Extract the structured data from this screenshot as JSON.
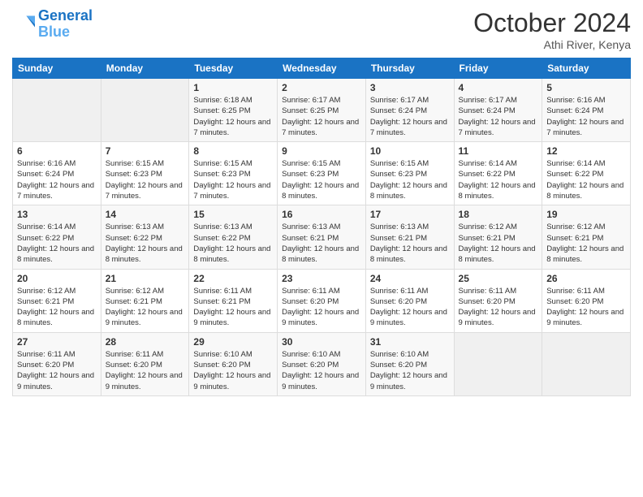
{
  "logo": {
    "line1": "General",
    "line2": "Blue"
  },
  "title": "October 2024",
  "subtitle": "Athi River, Kenya",
  "days_header": [
    "Sunday",
    "Monday",
    "Tuesday",
    "Wednesday",
    "Thursday",
    "Friday",
    "Saturday"
  ],
  "weeks": [
    [
      {
        "day": "",
        "info": ""
      },
      {
        "day": "",
        "info": ""
      },
      {
        "day": "1",
        "info": "Sunrise: 6:18 AM\nSunset: 6:25 PM\nDaylight: 12 hours and 7 minutes."
      },
      {
        "day": "2",
        "info": "Sunrise: 6:17 AM\nSunset: 6:25 PM\nDaylight: 12 hours and 7 minutes."
      },
      {
        "day": "3",
        "info": "Sunrise: 6:17 AM\nSunset: 6:24 PM\nDaylight: 12 hours and 7 minutes."
      },
      {
        "day": "4",
        "info": "Sunrise: 6:17 AM\nSunset: 6:24 PM\nDaylight: 12 hours and 7 minutes."
      },
      {
        "day": "5",
        "info": "Sunrise: 6:16 AM\nSunset: 6:24 PM\nDaylight: 12 hours and 7 minutes."
      }
    ],
    [
      {
        "day": "6",
        "info": "Sunrise: 6:16 AM\nSunset: 6:24 PM\nDaylight: 12 hours and 7 minutes."
      },
      {
        "day": "7",
        "info": "Sunrise: 6:15 AM\nSunset: 6:23 PM\nDaylight: 12 hours and 7 minutes."
      },
      {
        "day": "8",
        "info": "Sunrise: 6:15 AM\nSunset: 6:23 PM\nDaylight: 12 hours and 7 minutes."
      },
      {
        "day": "9",
        "info": "Sunrise: 6:15 AM\nSunset: 6:23 PM\nDaylight: 12 hours and 8 minutes."
      },
      {
        "day": "10",
        "info": "Sunrise: 6:15 AM\nSunset: 6:23 PM\nDaylight: 12 hours and 8 minutes."
      },
      {
        "day": "11",
        "info": "Sunrise: 6:14 AM\nSunset: 6:22 PM\nDaylight: 12 hours and 8 minutes."
      },
      {
        "day": "12",
        "info": "Sunrise: 6:14 AM\nSunset: 6:22 PM\nDaylight: 12 hours and 8 minutes."
      }
    ],
    [
      {
        "day": "13",
        "info": "Sunrise: 6:14 AM\nSunset: 6:22 PM\nDaylight: 12 hours and 8 minutes."
      },
      {
        "day": "14",
        "info": "Sunrise: 6:13 AM\nSunset: 6:22 PM\nDaylight: 12 hours and 8 minutes."
      },
      {
        "day": "15",
        "info": "Sunrise: 6:13 AM\nSunset: 6:22 PM\nDaylight: 12 hours and 8 minutes."
      },
      {
        "day": "16",
        "info": "Sunrise: 6:13 AM\nSunset: 6:21 PM\nDaylight: 12 hours and 8 minutes."
      },
      {
        "day": "17",
        "info": "Sunrise: 6:13 AM\nSunset: 6:21 PM\nDaylight: 12 hours and 8 minutes."
      },
      {
        "day": "18",
        "info": "Sunrise: 6:12 AM\nSunset: 6:21 PM\nDaylight: 12 hours and 8 minutes."
      },
      {
        "day": "19",
        "info": "Sunrise: 6:12 AM\nSunset: 6:21 PM\nDaylight: 12 hours and 8 minutes."
      }
    ],
    [
      {
        "day": "20",
        "info": "Sunrise: 6:12 AM\nSunset: 6:21 PM\nDaylight: 12 hours and 8 minutes."
      },
      {
        "day": "21",
        "info": "Sunrise: 6:12 AM\nSunset: 6:21 PM\nDaylight: 12 hours and 9 minutes."
      },
      {
        "day": "22",
        "info": "Sunrise: 6:11 AM\nSunset: 6:21 PM\nDaylight: 12 hours and 9 minutes."
      },
      {
        "day": "23",
        "info": "Sunrise: 6:11 AM\nSunset: 6:20 PM\nDaylight: 12 hours and 9 minutes."
      },
      {
        "day": "24",
        "info": "Sunrise: 6:11 AM\nSunset: 6:20 PM\nDaylight: 12 hours and 9 minutes."
      },
      {
        "day": "25",
        "info": "Sunrise: 6:11 AM\nSunset: 6:20 PM\nDaylight: 12 hours and 9 minutes."
      },
      {
        "day": "26",
        "info": "Sunrise: 6:11 AM\nSunset: 6:20 PM\nDaylight: 12 hours and 9 minutes."
      }
    ],
    [
      {
        "day": "27",
        "info": "Sunrise: 6:11 AM\nSunset: 6:20 PM\nDaylight: 12 hours and 9 minutes."
      },
      {
        "day": "28",
        "info": "Sunrise: 6:11 AM\nSunset: 6:20 PM\nDaylight: 12 hours and 9 minutes."
      },
      {
        "day": "29",
        "info": "Sunrise: 6:10 AM\nSunset: 6:20 PM\nDaylight: 12 hours and 9 minutes."
      },
      {
        "day": "30",
        "info": "Sunrise: 6:10 AM\nSunset: 6:20 PM\nDaylight: 12 hours and 9 minutes."
      },
      {
        "day": "31",
        "info": "Sunrise: 6:10 AM\nSunset: 6:20 PM\nDaylight: 12 hours and 9 minutes."
      },
      {
        "day": "",
        "info": ""
      },
      {
        "day": "",
        "info": ""
      }
    ]
  ]
}
